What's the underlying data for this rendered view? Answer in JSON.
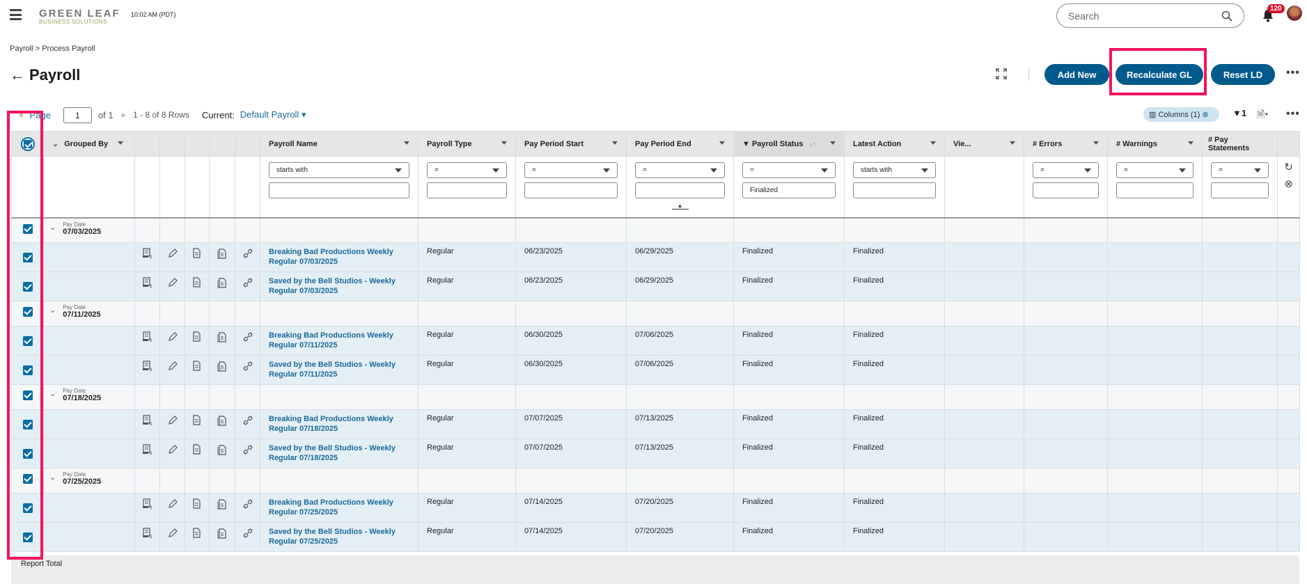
{
  "app": {
    "logo_line1": "GREEN LEAF",
    "logo_line2": "BUSINESS SOLUTIONS",
    "time": "10:02 AM (PDT)",
    "search_placeholder": "Search",
    "notification_count": "120"
  },
  "breadcrumb": {
    "root": "Payroll",
    "sep": ">",
    "current": "Process Payroll"
  },
  "page": {
    "title": "Payroll",
    "back_icon": "←"
  },
  "actions": {
    "add_new": "Add New",
    "recalculate_gl": "Recalculate GL",
    "reset_ld": "Reset LD",
    "more": "•••"
  },
  "pager": {
    "page_label": "Page",
    "page": "1",
    "of": "of 1",
    "rows": "1 - 8 of 8 Rows",
    "current_label": "Current:",
    "current_view": "Default Payroll"
  },
  "toolbar": {
    "columns": "Columns (1)",
    "filter_count": "1",
    "more": "•••"
  },
  "columns": {
    "grouped_by": "Grouped By",
    "payroll_name": "Payroll Name",
    "payroll_type": "Payroll Type",
    "pay_period_start": "Pay Period Start",
    "pay_period_end": "Pay Period End",
    "payroll_status": "Payroll Status",
    "latest_action": "Latest Action",
    "view": "Vie...",
    "errors": "# Errors",
    "warnings": "# Warnings",
    "pay_statements": "# Pay Statements"
  },
  "filters": {
    "payroll_name_op": "starts with",
    "payroll_type_op": "=",
    "pay_period_start_op": "=",
    "pay_period_end_op": "=",
    "payroll_status_op": "=",
    "payroll_status_value": "Finalized",
    "latest_action_op": "starts with",
    "errors_op": "=",
    "warnings_op": "=",
    "pay_statements_op": "="
  },
  "groups": [
    {
      "label": "Pay Date",
      "date": "07/03/2025",
      "rows": [
        {
          "name": "Breaking Bad Productions Weekly Regular 07/03/2025",
          "type": "Regular",
          "start": "06/23/2025",
          "end": "06/29/2025",
          "status": "Finalized",
          "action": "Finalized"
        },
        {
          "name": "Saved by the Bell Studios - Weekly Regular 07/03/2025",
          "type": "Regular",
          "start": "06/23/2025",
          "end": "06/29/2025",
          "status": "Finalized",
          "action": "Finalized"
        }
      ]
    },
    {
      "label": "Pay Date",
      "date": "07/11/2025",
      "rows": [
        {
          "name": "Breaking Bad Productions Weekly Regular 07/11/2025",
          "type": "Regular",
          "start": "06/30/2025",
          "end": "07/06/2025",
          "status": "Finalized",
          "action": "Finalized"
        },
        {
          "name": "Saved by the Bell Studios - Weekly Regular 07/11/2025",
          "type": "Regular",
          "start": "06/30/2025",
          "end": "07/06/2025",
          "status": "Finalized",
          "action": "Finalized"
        }
      ]
    },
    {
      "label": "Pay Date",
      "date": "07/18/2025",
      "rows": [
        {
          "name": "Breaking Bad Productions Weekly Regular 07/18/2025",
          "type": "Regular",
          "start": "07/07/2025",
          "end": "07/13/2025",
          "status": "Finalized",
          "action": "Finalized"
        },
        {
          "name": "Saved by the Bell Studios - Weekly Regular 07/18/2025",
          "type": "Regular",
          "start": "07/07/2025",
          "end": "07/13/2025",
          "status": "Finalized",
          "action": "Finalized"
        }
      ]
    },
    {
      "label": "Pay Date",
      "date": "07/25/2025",
      "rows": [
        {
          "name": "Breaking Bad Productions Weekly Regular 07/25/2025",
          "type": "Regular",
          "start": "07/14/2025",
          "end": "07/20/2025",
          "status": "Finalized",
          "action": "Finalized"
        },
        {
          "name": "Saved by the Bell Studios - Weekly Regular 07/25/2025",
          "type": "Regular",
          "start": "07/14/2025",
          "end": "07/20/2025",
          "status": "Finalized",
          "action": "Finalized"
        }
      ]
    }
  ],
  "footer": {
    "report_total": "Report Total"
  },
  "colors": {
    "primary": "#005a8c",
    "highlight": "#f5135a",
    "badge": "#d8112b",
    "link": "#1a6a9a"
  }
}
